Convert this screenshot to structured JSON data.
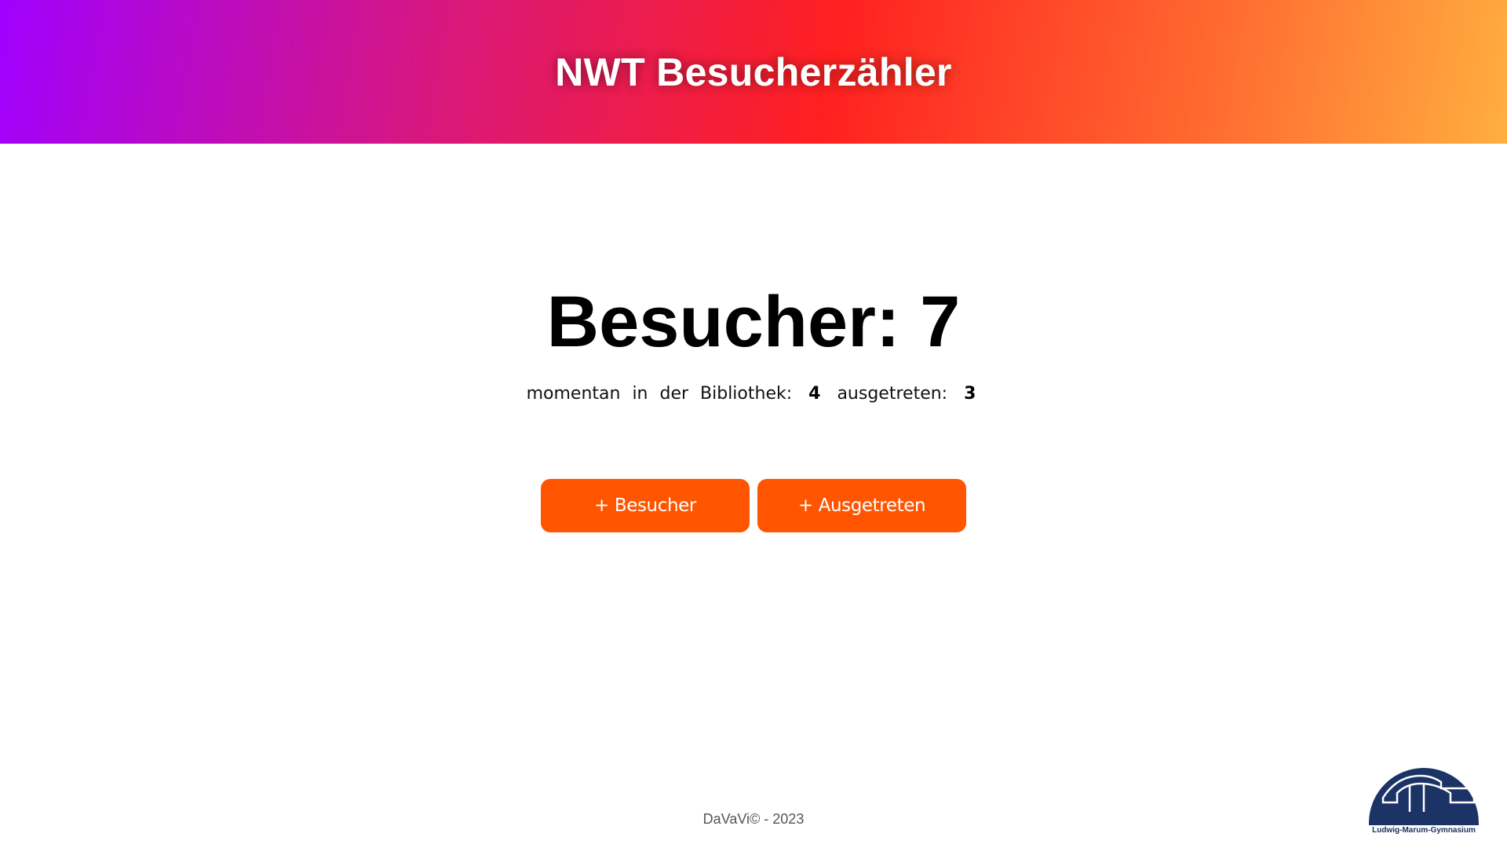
{
  "header": {
    "title": "NWT Besucherzähler"
  },
  "counter": {
    "label": "Besucher: 7"
  },
  "stats": {
    "inside_label": "momentan in der Bibliothek:",
    "inside_value": "4",
    "left_label": "ausgetreten:",
    "left_value": "3"
  },
  "buttons": {
    "add_visitor": "+ Besucher",
    "add_left": "+ Ausgetreten"
  },
  "footer": {
    "copyright": "DaVaVi© - 2023"
  },
  "logo": {
    "text": "Ludwig-Marum-Gymnasium",
    "color": "#1c3366"
  },
  "colors": {
    "accent": "#ff5500",
    "gradient": [
      "#a000ff",
      "#ff2020",
      "#ffae40"
    ]
  }
}
